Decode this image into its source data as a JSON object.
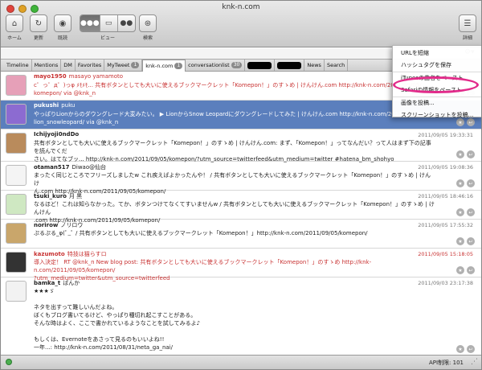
{
  "window": {
    "title": "knk-n.com"
  },
  "toolbar": {
    "home_label": "ホーム",
    "reload_label": "更新",
    "check_label": "既読",
    "view_label": "ビュー",
    "search_label": "検索",
    "detail_label": "詳細",
    "view_segments": [
      "●●●",
      "▭",
      "●●"
    ]
  },
  "tabs": [
    {
      "label": "Timeline"
    },
    {
      "label": "Mentions"
    },
    {
      "label": "DM"
    },
    {
      "label": "Favorites"
    },
    {
      "label": "MyTweet",
      "badge": "1"
    },
    {
      "label": "knk-n.com",
      "badge": "1",
      "selected": true
    },
    {
      "label": "conversationlist",
      "badge": "30"
    },
    {
      "label": "",
      "redacted": true
    },
    {
      "label": "",
      "redacted": true
    },
    {
      "label": "News"
    },
    {
      "label": "Search"
    }
  ],
  "menu": {
    "items": [
      "URLを短縮",
      "ハッシュタグを保存",
      "iTunesの曲名をペースト",
      "Safariの情報をペースト",
      "画像を投稿...",
      "スクリーンショットを投稿..."
    ]
  },
  "tweets": [
    {
      "name": "mayo1950",
      "screen": "masayo yamamoto",
      "time": "",
      "text": "c゜っ゜д゜)っφ ﾒﾓﾒﾓ... 共有ボタンとしても大いに使えるブックマークレット「Komepon！」のすゝめ | けんけん.com http://knk-n.com/2011/09/05/\nkomepon/ via @knk_n",
      "red": true
    },
    {
      "name": "pukushi",
      "screen": "puku",
      "time": "",
      "text": "やっぱりLionからのダウングレード大変みたい。 ▶ LionからSnow Leopardにダウングレードしてみた | けんけん.com http://knk-n.com/2011/09/02/\nlion_snowleopard/ via @knk_n",
      "selected": true
    },
    {
      "name": "Ichijyoji0ndDo",
      "screen": "",
      "time": "2011/09/05 19:33:31",
      "text": "共有ボタンとしても大いに使えるブックマークレット「Komepon！」のすゝめ | けんけん.com: まず、「Komepon！」ってなんだい？って人はまず下の記事を読んでくだ\nさい。はてなブッ... http://knk-n.com/2011/09/05/komepon/?utm_source=twitterfeed&utm_medium=twitter #hatena_bm_shohyo"
    },
    {
      "name": "otaman517",
      "screen": "Diwao@仙台",
      "time": "2011/09/05 19:08:36",
      "text": "まったく同じところでフリーズしましたw これ疾えばよかったんや！ / 共有ボタンとしても大いに使えるブックマークレット「Komepon！」のすゝめ | けんけ\nん.com http://knk-n.com/2011/09/05/komepon/"
    },
    {
      "name": "tsuki_kuro",
      "screen": "月 黒",
      "time": "2011/09/05 18:46:16",
      "text": "なるほど！これは知らなかった。てか、ボタンつけてなくてすいませんw / 共有ボタンとしても大いに使えるブックマークレット「Komepon！」のすゝめ | けんけん\n.com http://knk-n.com/2011/09/05/komepon/"
    },
    {
      "name": "norirow",
      "screen": "ノリロウ",
      "time": "2011/09/05 17:55:32",
      "text": "ぷるぷる_φ(ﾟ_ﾟ / 共有ボタンとしても大いに使えるブックマークレット「Komepon！」http://knk-n.com/2011/09/05/komepon/"
    },
    {
      "name": "kazumoto",
      "screen": "特技は猫らすロ",
      "time": "2011/09/05 15:18:05",
      "text": "導入決定！ RT @knk_n New blog post: 共有ボタンとしても大いに使えるブックマークレット「Komepon！」のすゝめ http://knk-n.com/2011/09/05/komepon/\n?utm_medium=twitter&utm_source=twitterfeed",
      "red": true
    },
    {
      "name": "bamka_t",
      "screen": "ばんか",
      "time": "2011/09/03 23:17:38",
      "text": "★★★ゞ\n\nネタを出すって難しいんだよね。\nぼくもブログ書いてるけど、やっぱり種切れ起こすことがある。\nそんな時はよく、ここで書かれているようなことを試してみるよ♪\n\nもしくは、Evernoteをあさって見るのもいいよね!!\n一年...: http://knk-n.com/2011/08/31/neta_ga_nai/"
    }
  ],
  "status": {
    "api_label": "API制限: 101"
  }
}
